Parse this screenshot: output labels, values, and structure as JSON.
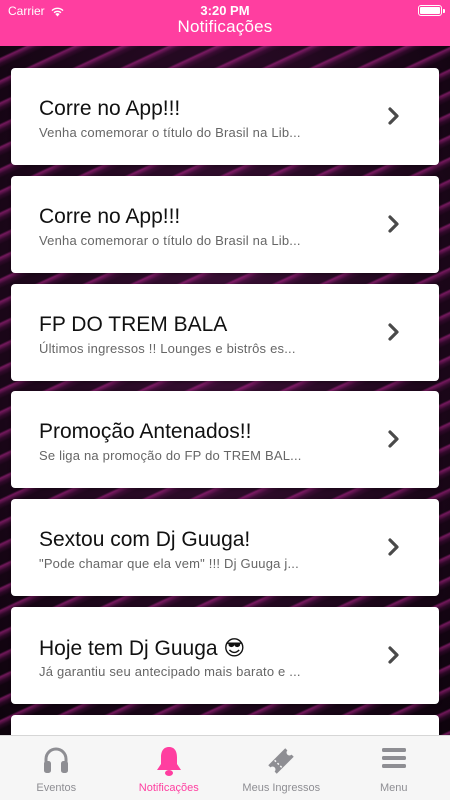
{
  "status": {
    "carrier": "Carrier",
    "time": "3:20 PM"
  },
  "header": {
    "title": "Notificações"
  },
  "notifications": [
    {
      "title": "Corre no App!!!",
      "subtitle": "Venha comemorar o título do Brasil na Lib..."
    },
    {
      "title": "Corre no App!!!",
      "subtitle": "Venha comemorar o título do Brasil na Lib..."
    },
    {
      "title": "FP DO TREM BALA",
      "subtitle": "Últimos ingressos !! Lounges e bistrôs es..."
    },
    {
      "title": "Promoção Antenados!!",
      "subtitle": "Se liga na promoção do FP do TREM BAL..."
    },
    {
      "title": "Sextou com Dj Guuga!",
      "subtitle": "\"Pode chamar que ela vem\" !!! Dj Guuga j..."
    },
    {
      "title": "Hoje tem Dj Guuga 😎",
      "subtitle": "Já garantiu seu antecipado mais barato e ..."
    }
  ],
  "tabs": [
    {
      "label": "Eventos",
      "icon": "headphones-icon"
    },
    {
      "label": "Notificações",
      "icon": "bell-icon"
    },
    {
      "label": "Meus Ingressos",
      "icon": "ticket-icon"
    },
    {
      "label": "Menu",
      "icon": "menu-icon"
    }
  ],
  "colors": {
    "accent": "#ff3ea0",
    "tab_inactive": "#8e8e93"
  }
}
